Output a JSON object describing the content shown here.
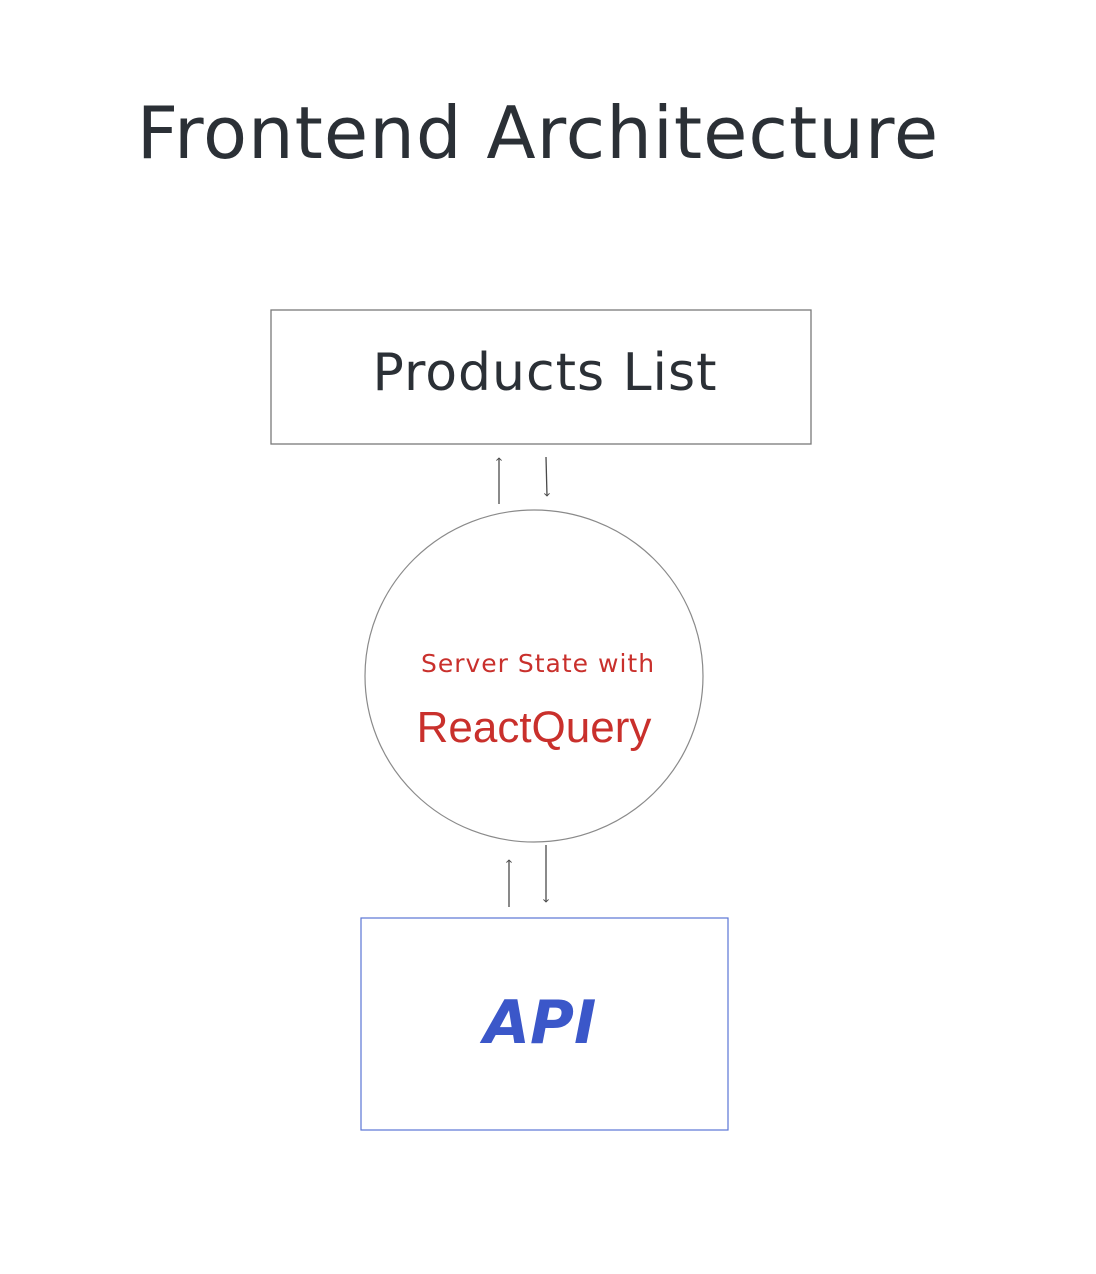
{
  "diagram": {
    "title": "Frontend Architecture",
    "nodes": {
      "products_list": {
        "label": "Products List"
      },
      "server_state": {
        "label_top": "Server State with",
        "label_main": "ReactQuery"
      },
      "api": {
        "label": "API"
      }
    },
    "edges": [
      {
        "from": "server_state",
        "to": "products_list",
        "kind": "arrow"
      },
      {
        "from": "products_list",
        "to": "server_state",
        "kind": "arrow"
      },
      {
        "from": "api",
        "to": "server_state",
        "kind": "arrow"
      },
      {
        "from": "server_state",
        "to": "api",
        "kind": "arrow"
      }
    ],
    "colors": {
      "title": "#2b3036",
      "box_border": "#7a7a7a",
      "circle_border": "#8a8a8a",
      "react_query_text": "#c9302c",
      "api_text": "#3b57c9",
      "api_border": "#5b76d4"
    }
  }
}
